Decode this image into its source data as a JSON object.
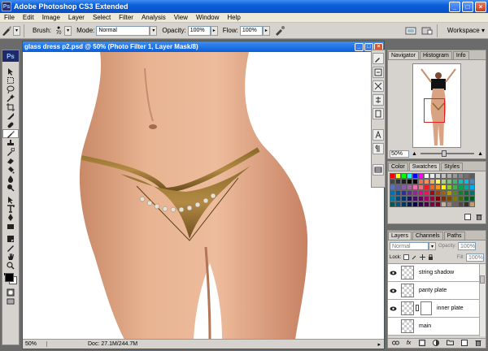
{
  "app": {
    "title": "Adobe Photoshop CS3 Extended",
    "badge": "Ps",
    "minimize": "_",
    "maximize": "□",
    "close": "×"
  },
  "menu": [
    "File",
    "Edit",
    "Image",
    "Layer",
    "Select",
    "Filter",
    "Analysis",
    "View",
    "Window",
    "Help"
  ],
  "options": {
    "brush_label": "Brush:",
    "brush_size": "70",
    "mode_label": "Mode:",
    "mode_value": "Normal",
    "opacity_label": "Opacity:",
    "opacity_value": "100%",
    "flow_label": "Flow:",
    "flow_value": "100%",
    "workspace_label": "Workspace ▾"
  },
  "toolbox": {
    "logo": "Ps"
  },
  "document": {
    "title": "glass dress p2.psd @ 50% (Photo Filter 1, Layer Mask/8)",
    "zoom": "50%",
    "doc_size": "Doc: 27.1M/244.7M"
  },
  "navigator": {
    "tabs": [
      "Navigator",
      "Histogram",
      "Info"
    ],
    "zoom": "50%"
  },
  "swatches": {
    "tabs": [
      "Color",
      "Swatches",
      "Styles"
    ],
    "colors": [
      "#ff0000",
      "#ffff00",
      "#00ff00",
      "#00ffff",
      "#0000ff",
      "#ff00ff",
      "#ffffff",
      "#ebebeb",
      "#d6d6d6",
      "#c2c2c2",
      "#adadad",
      "#999999",
      "#858585",
      "#707070",
      "#5c5c5c",
      "#474747",
      "#333333",
      "#1f1f1f",
      "#0a0a0a",
      "#000000",
      "#f26c4f",
      "#f68e55",
      "#fbaf5c",
      "#fff467",
      "#acd372",
      "#7cc576",
      "#3bb878",
      "#1abbb4",
      "#00bff3",
      "#438ccb",
      "#5574b9",
      "#605ca8",
      "#855fa8",
      "#a763a8",
      "#f06ea9",
      "#f26d7d",
      "#ed1c24",
      "#f26522",
      "#f7941d",
      "#fff200",
      "#8dc73f",
      "#39b54a",
      "#00a651",
      "#00a99d",
      "#00aeef",
      "#0072bc",
      "#0054a6",
      "#2e3192",
      "#662d91",
      "#92278f",
      "#ec008c",
      "#ed145b",
      "#9e0b0f",
      "#a0410d",
      "#a36209",
      "#aba000",
      "#598527",
      "#197b30",
      "#007236",
      "#00746b",
      "#0076a3",
      "#004b80",
      "#003471",
      "#1b1464",
      "#440e62",
      "#630460",
      "#9e005d",
      "#9e0039",
      "#790000",
      "#7b2e00",
      "#7d4900",
      "#827b00",
      "#406618",
      "#005e20",
      "#005826",
      "#005952",
      "#005b7f",
      "#003663",
      "#002157",
      "#0d004c",
      "#32004b",
      "#4b0049",
      "#7b0046",
      "#7a0026",
      "#c7b299",
      "#998675",
      "#736357",
      "#534741",
      "#362f2d",
      "#c69c6d"
    ]
  },
  "layers": {
    "tabs": [
      "Layers",
      "Channels",
      "Paths"
    ],
    "blend": "Normal",
    "opacity_label": "Opacity:",
    "opacity_value": "100%",
    "lock_label": "Lock:",
    "fill_label": "Fill:",
    "fill_value": "100%",
    "items": [
      {
        "name": "string shadow"
      },
      {
        "name": "panty plate"
      },
      {
        "name": "inner plate"
      },
      {
        "name": "main"
      }
    ]
  }
}
